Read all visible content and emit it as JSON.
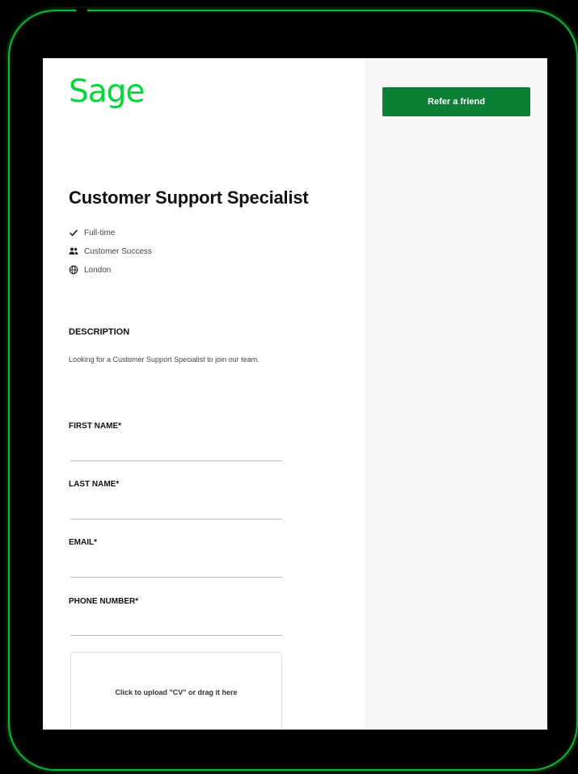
{
  "brand": {
    "logo_text": "Sage",
    "accent": "#00d639",
    "button_color": "#0b7f36"
  },
  "sidebar": {
    "refer_label": "Refer a friend"
  },
  "job": {
    "title": "Customer Support Specialist",
    "meta": [
      {
        "icon": "checkmark-icon",
        "text": "Full-time"
      },
      {
        "icon": "people-icon",
        "text": "Customer Success"
      },
      {
        "icon": "globe-icon",
        "text": "London"
      }
    ],
    "description_heading": "DESCRIPTION",
    "description": "Looking for a Customer Support Specialist to join our team."
  },
  "form": {
    "first_name_label": "FIRST NAME*",
    "first_name_value": "",
    "last_name_label": "LAST NAME*",
    "last_name_value": "",
    "email_label": "EMAIL*",
    "email_value": "",
    "phone_label": "PHONE NUMBER*",
    "phone_value": "",
    "upload_text": "Click to upload \"CV\" or drag it here"
  }
}
